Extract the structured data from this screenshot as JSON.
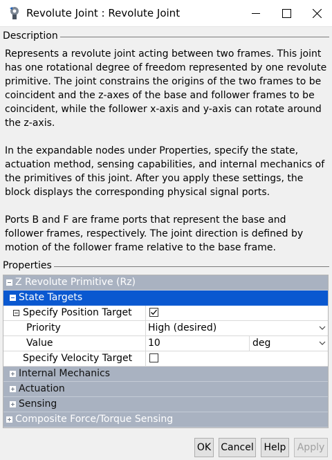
{
  "window": {
    "title": "Revolute Joint : Revolute Joint"
  },
  "description": {
    "header": "Description",
    "paragraphs": [
      "Represents a revolute joint acting between two frames. This joint has one rotational degree of freedom represented by one revolute primitive. The joint constrains the origins of the two frames to be coincident and the z-axes of the base and follower frames to be coincident, while the follower x-axis and y-axis can rotate around the z-axis.",
      "In the expandable nodes under Properties, specify the state, actuation method, sensing capabilities, and internal mechanics of the primitives of this joint. After you apply these settings, the block displays the corresponding physical signal ports.",
      "Ports B and F are frame ports that represent the base and follower frames, respectively. The joint direction is defined by motion of the follower frame relative to the base frame."
    ]
  },
  "properties": {
    "header": "Properties",
    "primitive": "Z Revolute Primitive (Rz)",
    "state_targets": "State Targets",
    "specify_position_target": {
      "label": "Specify Position Target",
      "checked": true
    },
    "priority": {
      "label": "Priority",
      "value": "High (desired)"
    },
    "value": {
      "label": "Value",
      "value": "10",
      "unit": "deg"
    },
    "specify_velocity_target": {
      "label": "Specify Velocity Target",
      "checked": false
    },
    "internal_mechanics": "Internal Mechanics",
    "actuation": "Actuation",
    "sensing": "Sensing",
    "composite": "Composite Force/Torque Sensing"
  },
  "buttons": {
    "ok": "OK",
    "cancel": "Cancel",
    "help": "Help",
    "apply": "Apply"
  }
}
